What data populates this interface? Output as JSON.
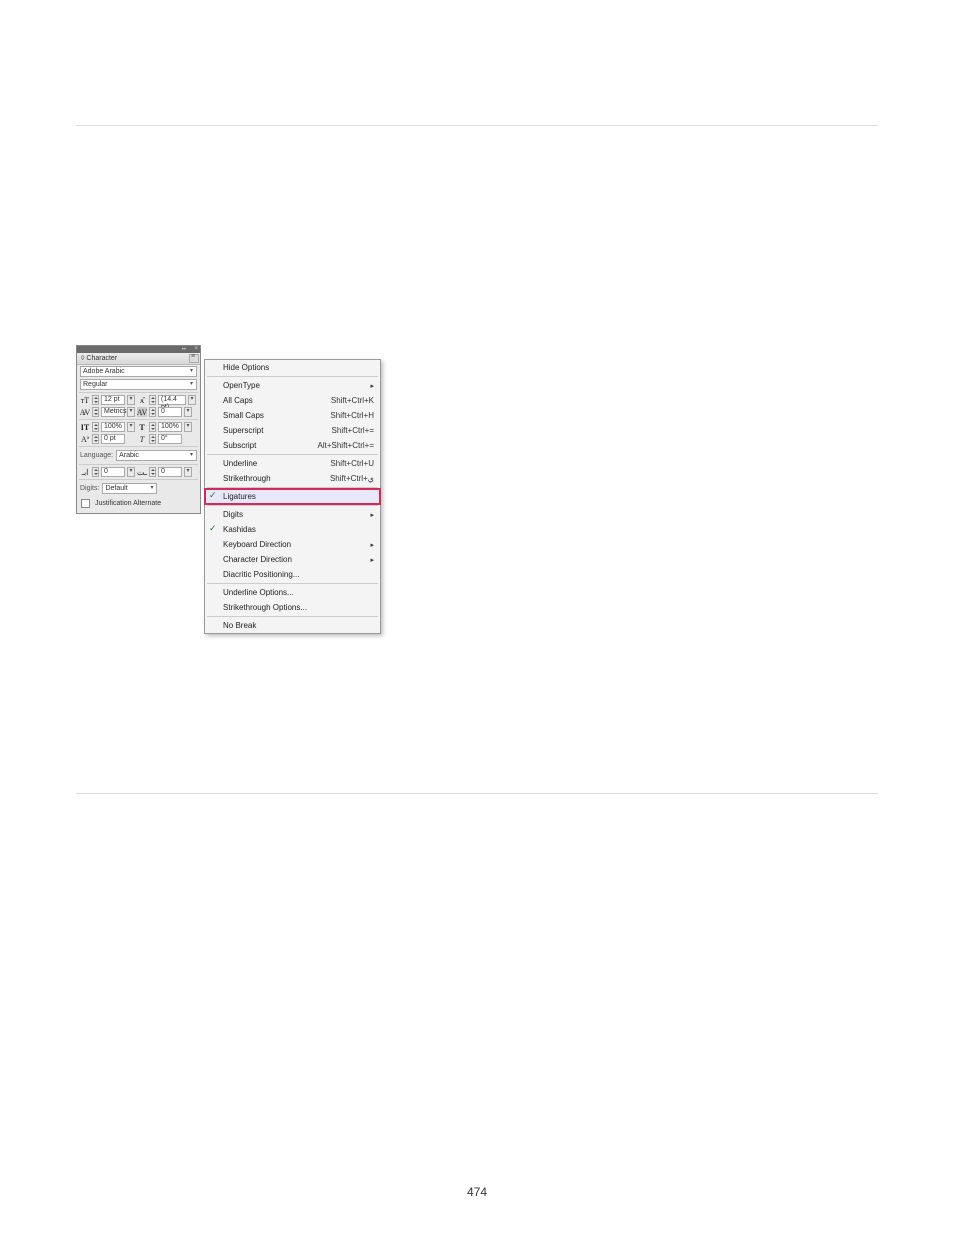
{
  "page_number": "474",
  "panel": {
    "title": "◊ Character",
    "font_family": "Adobe Arabic",
    "font_style": "Regular",
    "size": "12 pt",
    "leading": "(14.4 pt)",
    "kerning": "Metrics",
    "tracking": "0",
    "vscale": "100%",
    "hscale": "100%",
    "baseline": "0 pt",
    "skew": "0°",
    "language_label": "Language:",
    "language": "Arabic",
    "d1": "0",
    "d2": "0",
    "digits_label": "Digits:",
    "digits_value": "Default",
    "justification_alt": "Justification Alternate"
  },
  "menu": {
    "hide_options": "Hide Options",
    "opentype": "OpenType",
    "allcaps": {
      "label": "All Caps",
      "short": "Shift+Ctrl+K"
    },
    "smallcaps": {
      "label": "Small Caps",
      "short": "Shift+Ctrl+H"
    },
    "superscript": {
      "label": "Superscript",
      "short": "Shift+Ctrl+="
    },
    "subscript": {
      "label": "Subscript",
      "short": "Alt+Shift+Ctrl+="
    },
    "underline": {
      "label": "Underline",
      "short": "Shift+Ctrl+U"
    },
    "strike": {
      "label": "Strikethrough",
      "short": "Shift+Ctrl+ي"
    },
    "ligatures": "Ligatures",
    "digits": "Digits",
    "kashidas": "Kashidas",
    "keyboard_dir": "Keyboard Direction",
    "char_dir": "Character Direction",
    "diacritic": "Diacritic Positioning...",
    "under_opts": "Underline Options...",
    "strike_opts": "Strikethrough Options...",
    "nobreak": "No Break"
  }
}
